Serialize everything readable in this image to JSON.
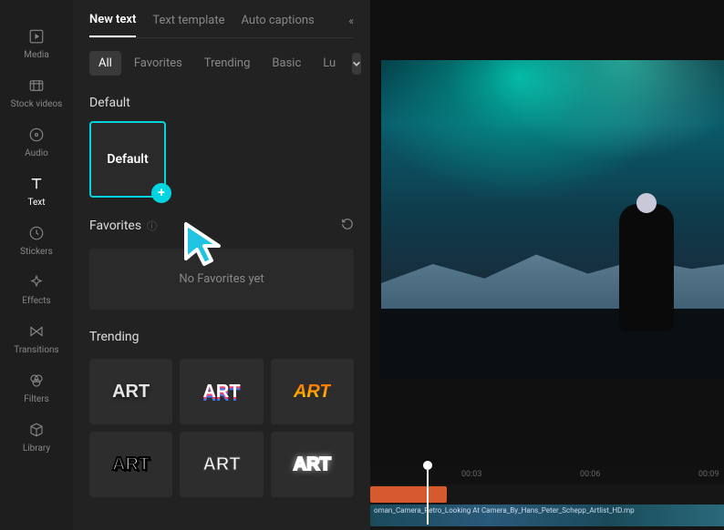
{
  "sidebar": {
    "items": [
      {
        "label": "Media",
        "name": "sidebar-item-media",
        "icon": "play-square"
      },
      {
        "label": "Stock videos",
        "name": "sidebar-item-stock-videos",
        "icon": "film"
      },
      {
        "label": "Audio",
        "name": "sidebar-item-audio",
        "icon": "disc"
      },
      {
        "label": "Text",
        "name": "sidebar-item-text",
        "icon": "text",
        "active": true
      },
      {
        "label": "Stickers",
        "name": "sidebar-item-stickers",
        "icon": "clock"
      },
      {
        "label": "Effects",
        "name": "sidebar-item-effects",
        "icon": "sparkle"
      },
      {
        "label": "Transitions",
        "name": "sidebar-item-transitions",
        "icon": "transitions"
      },
      {
        "label": "Filters",
        "name": "sidebar-item-filters",
        "icon": "filters"
      },
      {
        "label": "Library",
        "name": "sidebar-item-library",
        "icon": "cube"
      }
    ]
  },
  "panel": {
    "tabs": [
      {
        "label": "New text",
        "active": true
      },
      {
        "label": "Text template"
      },
      {
        "label": "Auto captions"
      }
    ],
    "filters": [
      {
        "label": "All",
        "active": true
      },
      {
        "label": "Favorites"
      },
      {
        "label": "Trending"
      },
      {
        "label": "Basic"
      },
      {
        "label": "Lu"
      }
    ],
    "sections": {
      "default": {
        "title": "Default",
        "card_label": "Default"
      },
      "favorites": {
        "title": "Favorites",
        "empty_text": "No Favorites yet"
      },
      "trending": {
        "title": "Trending",
        "card_text": "ART"
      }
    }
  },
  "timeline": {
    "ticks": [
      "00:03",
      "00:06",
      "00:09"
    ],
    "clip_label": "oman_Camera_Retro_Looking At Camera_By_Hans_Peter_Schepp_Artlist_HD.mp"
  }
}
